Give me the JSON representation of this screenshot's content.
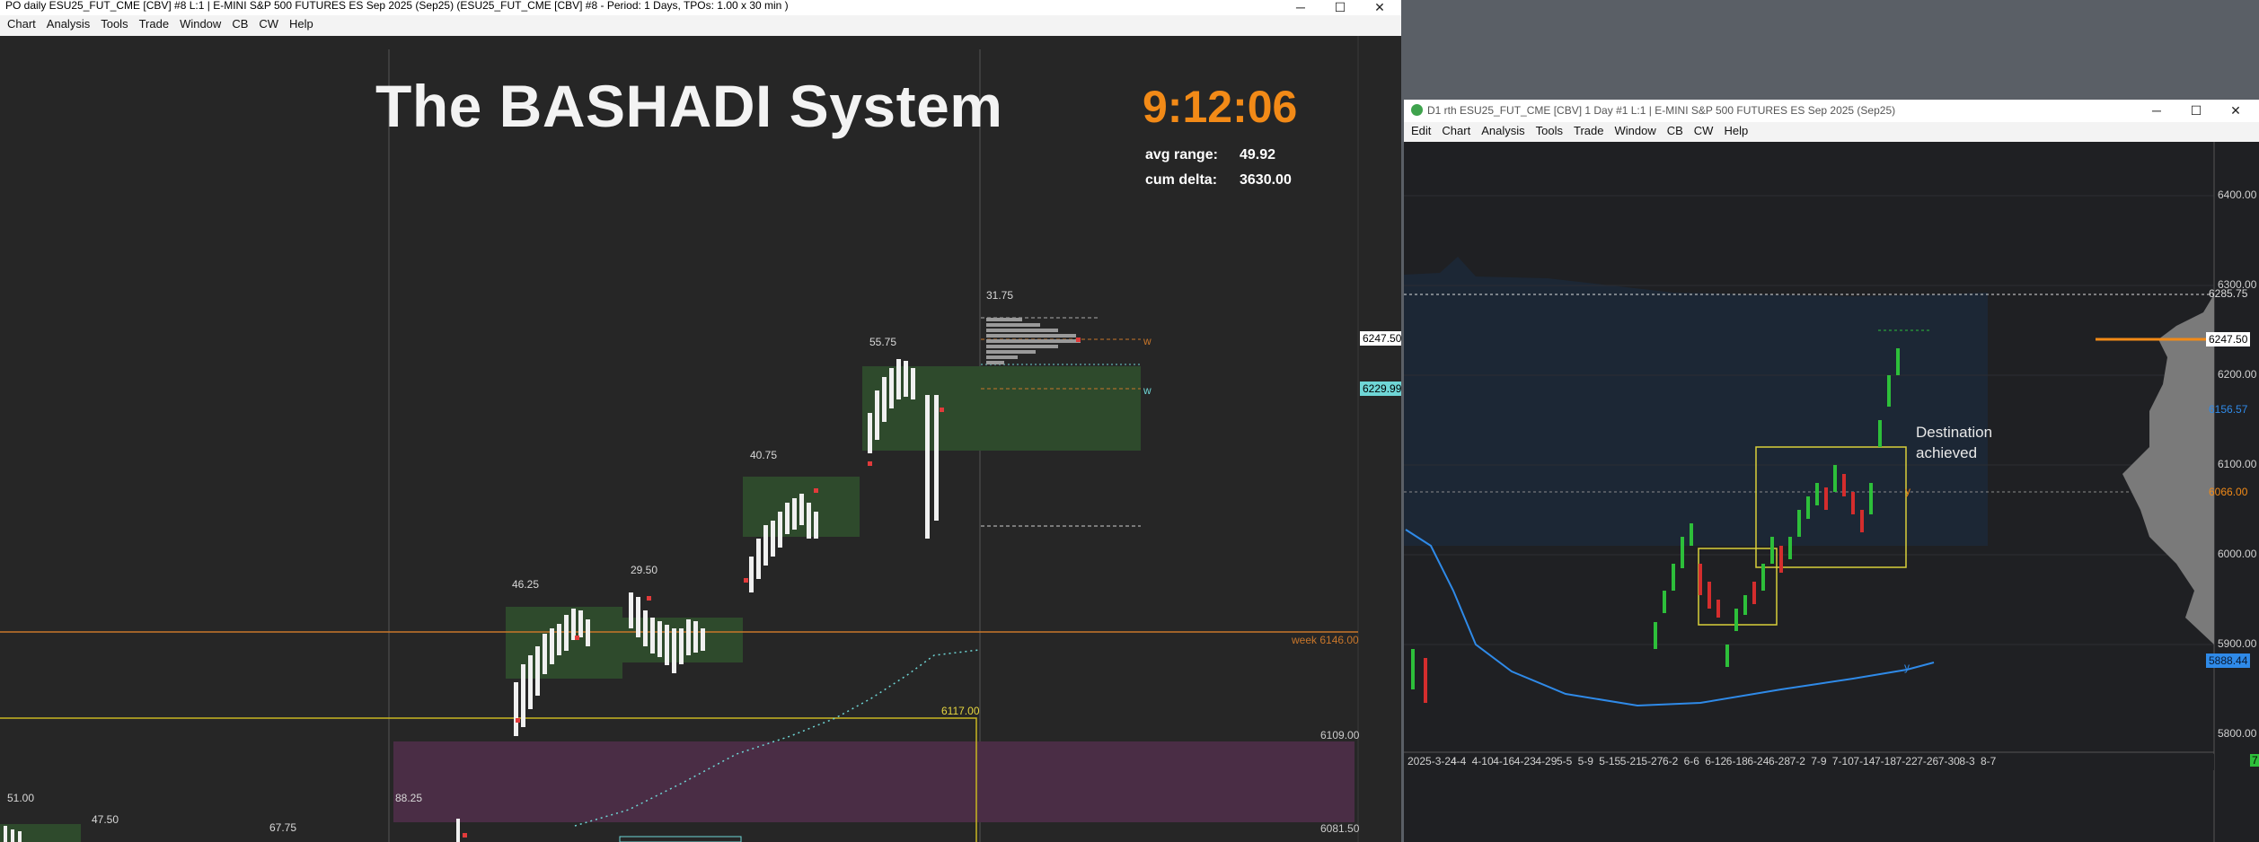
{
  "left_window": {
    "title": "PO daily ESU25_FUT_CME [CBV] #8 L:1 | E-MINI S&P 500 FUTURES ES Sep 2025 (Sep25) (ESU25_FUT_CME [CBV] #8 - Period: 1 Days, TPOs: 1.00 x 30 min  )",
    "controls": {
      "minimize": "─",
      "maximize": "☐",
      "close": "✕"
    },
    "menu": [
      "Chart",
      "Analysis",
      "Tools",
      "Trade",
      "Window",
      "CB",
      "CW",
      "Help"
    ],
    "system_title": "The BASHADI System",
    "clock": "9:12:06",
    "stats": {
      "avg_range_label": "avg range:",
      "avg_range_value": "49.92",
      "cum_delta_label": "cum delta:",
      "cum_delta_value": "3630.00"
    },
    "profile_labels": [
      "31.75",
      "55.75",
      "40.75",
      "46.25",
      "29.50",
      "88.25",
      "67.75",
      "51.00",
      "47.50"
    ],
    "level_labels": {
      "week": "week  6146.00",
      "level_6117": "6117.00",
      "level_6109": "6109.00",
      "level_6081": "6081.50"
    },
    "price_tags": {
      "p6247": "6247.50",
      "p6229": "6229.99"
    },
    "markers": {
      "w1": "w",
      "w2": "w"
    },
    "colors": {
      "background": "#262626",
      "value_area": "#2e4a2c",
      "orange_level": "#c8762a",
      "yellow_level": "#c9b620",
      "cyan": "#6fd6d6",
      "purple_zone": "#4a2d45",
      "clock": "#f28a17"
    }
  },
  "right_window": {
    "title": "D1 rth ESU25_FUT_CME [CBV]  1 Day  #1 L:1 | E-MINI S&P 500 FUTURES ES Sep 2025 (Sep25)",
    "controls": {
      "minimize": "─",
      "maximize": "☐",
      "close": "✕"
    },
    "menu": [
      "Edit",
      "Chart",
      "Analysis",
      "Tools",
      "Trade",
      "Window",
      "CB",
      "CW",
      "Help"
    ],
    "y_axis": [
      "6400.00",
      "6300.00",
      "6200.00",
      "6100.00",
      "6000.00",
      "5900.00",
      "5800.00"
    ],
    "price_tags": {
      "p6285": "6285.75",
      "p6247": "6247.50",
      "p6156": "6156.57",
      "p6066": "6066.00",
      "p5888": "5888.44"
    },
    "dates": [
      "2025-3-24",
      "4-4",
      "4-10",
      "4-16",
      "4-23",
      "4-29",
      "5-5",
      "5-9",
      "5-15",
      "5-21",
      "5-27",
      "6-2",
      "6-6",
      "6-12",
      "6-18",
      "6-24",
      "6-28",
      "7-2",
      "7-9",
      "7-10",
      "7-14",
      "7-18",
      "7-22",
      "7-26",
      "7-30",
      "8-3",
      "8-7"
    ],
    "annotation": "Destination achieved",
    "markers": {
      "y1": "y",
      "y2": "y",
      "corner": "7"
    },
    "colors": {
      "background": "#1f2023",
      "cloud": "#1c2735",
      "blue_line": "#2f8ae8",
      "bull": "#2dbf3a",
      "bear": "#d42d2d",
      "box": "#d9cf3a"
    }
  }
}
